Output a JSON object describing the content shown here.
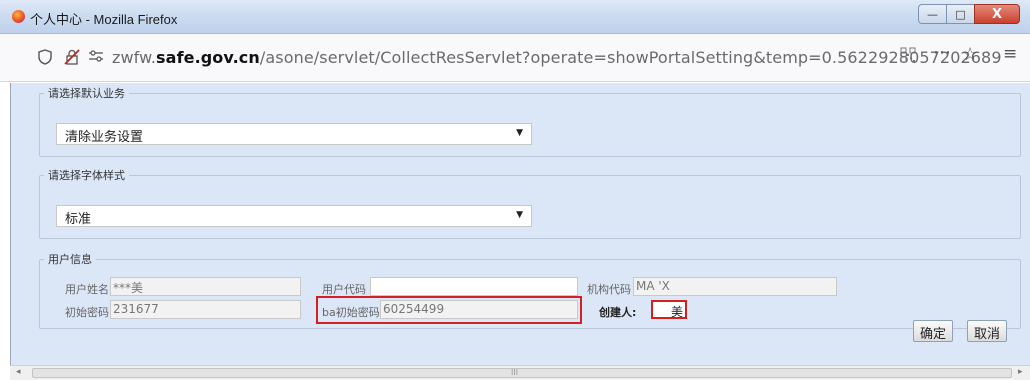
{
  "window": {
    "title": "个人中心 - Mozilla Firefox",
    "controls": {
      "minimize": "—",
      "maximize": "□",
      "close": "X"
    }
  },
  "navbar": {
    "url_prefix": "zwfw.",
    "url_domain": "safe.gov.cn",
    "url_path": "/asone/servlet/CollectResServlet?operate=showPortalSetting&temp=0.5622928057202689",
    "icons": [
      "shield-icon",
      "lock-warning-icon",
      "permissions-icon",
      "qr-code-icon",
      "more-icon",
      "bookmark-star-icon",
      "menu-icon"
    ]
  },
  "default_business": {
    "legend": "请选择默认业务",
    "selected": "清除业务设置"
  },
  "font_style": {
    "legend": "请选择字体样式",
    "selected": "标准"
  },
  "user_info": {
    "legend": "用户信息",
    "user_name_label": "用户姓名",
    "user_name_value": "***美",
    "user_code_label": "用户代码",
    "user_code_value": "",
    "org_code_label": "机构代码",
    "org_code_value": "MA          'X",
    "init_password_label": "初始密码",
    "init_password_value": "231677",
    "ba_password_label": "ba初始密码",
    "ba_password_value": "60254499",
    "creator_label": "创建人:",
    "creator_value": "美"
  },
  "buttons": {
    "confirm": "确定",
    "cancel": "取消"
  },
  "scrollbar": {
    "grip": "III"
  }
}
